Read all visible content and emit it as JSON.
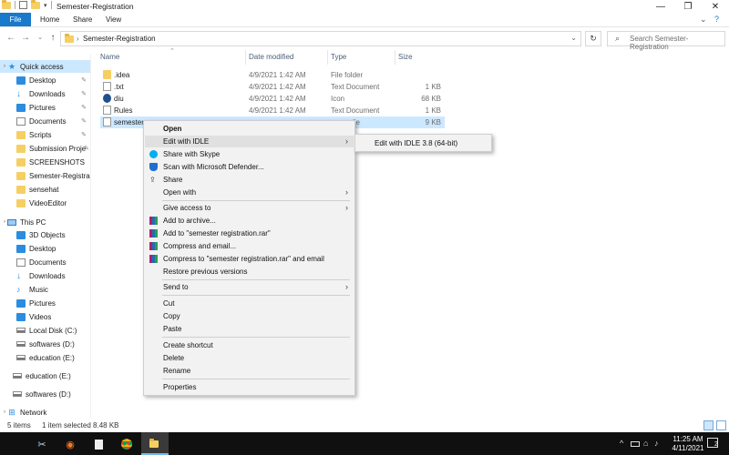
{
  "window": {
    "title": "Semester-Registration",
    "controls": {
      "minimize": "—",
      "maximize": "❐",
      "close": "✕"
    }
  },
  "ribbon": {
    "tabs": [
      "File",
      "Home",
      "Share",
      "View"
    ],
    "help_glyph": "?",
    "expand_glyph": "⌄"
  },
  "addressbar": {
    "path": "Semester-Registration",
    "search_placeholder": "Search Semester-Registration"
  },
  "sidebar": {
    "items": [
      {
        "label": "Quick access",
        "icon": "star-icon",
        "pinned": false
      },
      {
        "label": "Desktop",
        "icon": "folder-icon",
        "pinned": true
      },
      {
        "label": "Downloads",
        "icon": "download-icon",
        "pinned": true
      },
      {
        "label": "Pictures",
        "icon": "folder-icon",
        "pinned": true
      },
      {
        "label": "Documents",
        "icon": "folder-icon",
        "pinned": true
      },
      {
        "label": "Scripts",
        "icon": "folder-icon",
        "pinned": true
      },
      {
        "label": "Submission Proje",
        "icon": "folder-icon",
        "pinned": true
      },
      {
        "label": "SCREENSHOTS",
        "icon": "folder-icon",
        "pinned": false
      },
      {
        "label": "Semester-Registrati",
        "icon": "folder-icon",
        "pinned": false
      },
      {
        "label": "sensehat",
        "icon": "folder-icon",
        "pinned": false
      },
      {
        "label": "VideoEditor",
        "icon": "folder-icon",
        "pinned": false
      },
      {
        "label": "This PC",
        "icon": "pc-icon",
        "pinned": false
      },
      {
        "label": "3D Objects",
        "icon": "folder-icon",
        "pinned": false
      },
      {
        "label": "Desktop",
        "icon": "folder-icon",
        "pinned": false
      },
      {
        "label": "Documents",
        "icon": "folder-icon",
        "pinned": false
      },
      {
        "label": "Downloads",
        "icon": "download-icon",
        "pinned": false
      },
      {
        "label": "Music",
        "icon": "music-icon",
        "pinned": false
      },
      {
        "label": "Pictures",
        "icon": "folder-icon",
        "pinned": false
      },
      {
        "label": "Videos",
        "icon": "folder-icon",
        "pinned": false
      },
      {
        "label": "Local Disk (C:)",
        "icon": "drive-icon",
        "pinned": false
      },
      {
        "label": "softwares (D:)",
        "icon": "drive-icon",
        "pinned": false
      },
      {
        "label": "education (E:)",
        "icon": "drive-icon",
        "pinned": false
      },
      {
        "label": "education (E:)",
        "icon": "drive-icon",
        "pinned": false
      },
      {
        "label": "softwares (D:)",
        "icon": "drive-icon",
        "pinned": false
      },
      {
        "label": "Network",
        "icon": "network-icon",
        "pinned": false
      }
    ]
  },
  "filelist": {
    "columns": {
      "name": "Name",
      "date": "Date modified",
      "type": "Type",
      "size": "Size"
    },
    "rows": [
      {
        "name": ".idea",
        "date": "4/9/2021 1:42 AM",
        "type": "File folder",
        "size": "",
        "icon": "folder-icon"
      },
      {
        "name": ".txt",
        "date": "4/9/2021 1:42 AM",
        "type": "Text Document",
        "size": "1 KB",
        "icon": "document-icon"
      },
      {
        "name": "diu",
        "date": "4/9/2021 1:42 AM",
        "type": "Icon",
        "size": "68 KB",
        "icon": "ico-file-icon"
      },
      {
        "name": "Rules",
        "date": "4/9/2021 1:42 AM",
        "type": "Text Document",
        "size": "1 KB",
        "icon": "document-icon"
      },
      {
        "name": "semester r",
        "date": "",
        "type": "ile",
        "size": "9 KB",
        "icon": "python-file-icon"
      }
    ]
  },
  "status": {
    "items_count": "5 items",
    "selection": "1 item selected  8.48 KB"
  },
  "context_menu": {
    "items": [
      {
        "label": "Open",
        "bold": true,
        "submenu": false,
        "icon": ""
      },
      {
        "label": "Edit with IDLE",
        "bold": false,
        "submenu": true,
        "icon": ""
      },
      {
        "label": "Share with Skype",
        "bold": false,
        "submenu": false,
        "icon": "skype-icon"
      },
      {
        "label": "Scan with Microsoft Defender...",
        "bold": false,
        "submenu": false,
        "icon": "defender-icon"
      },
      {
        "label": "Share",
        "bold": false,
        "submenu": false,
        "icon": "share-icon"
      },
      {
        "label": "Open with",
        "bold": false,
        "submenu": true,
        "icon": ""
      },
      {
        "label": "Give access to",
        "bold": false,
        "submenu": true,
        "icon": ""
      },
      {
        "label": "Add to archive...",
        "bold": false,
        "submenu": false,
        "icon": "winrar-icon"
      },
      {
        "label": "Add to \"semester registration.rar\"",
        "bold": false,
        "submenu": false,
        "icon": "winrar-icon"
      },
      {
        "label": "Compress and email...",
        "bold": false,
        "submenu": false,
        "icon": "winrar-icon"
      },
      {
        "label": "Compress to \"semester registration.rar\" and email",
        "bold": false,
        "submenu": false,
        "icon": "winrar-icon"
      },
      {
        "label": "Restore previous versions",
        "bold": false,
        "submenu": false,
        "icon": ""
      },
      {
        "label": "Send to",
        "bold": false,
        "submenu": true,
        "icon": ""
      },
      {
        "label": "Cut",
        "bold": false,
        "submenu": false,
        "icon": ""
      },
      {
        "label": "Copy",
        "bold": false,
        "submenu": false,
        "icon": ""
      },
      {
        "label": "Paste",
        "bold": false,
        "submenu": false,
        "icon": ""
      },
      {
        "label": "Create shortcut",
        "bold": false,
        "submenu": false,
        "icon": ""
      },
      {
        "label": "Delete",
        "bold": false,
        "submenu": false,
        "icon": ""
      },
      {
        "label": "Rename",
        "bold": false,
        "submenu": false,
        "icon": ""
      },
      {
        "label": "Properties",
        "bold": false,
        "submenu": false,
        "icon": ""
      }
    ],
    "submenu_arrow": "›",
    "submenu": {
      "label": "Edit with IDLE 3.8 (64-bit)"
    }
  },
  "taskbar": {
    "apps": [
      "snipping-tool-icon",
      "blender-icon",
      "file-icon",
      "chrome-icon",
      "file-explorer-icon"
    ],
    "tray_glyphs": {
      "chevron": "^",
      "network": "⌂",
      "volume": "♪"
    },
    "time": "11:25 AM",
    "date": "4/11/2021",
    "notifications": "2"
  },
  "colors": {
    "accent": "#1979ca",
    "selection": "#cce8ff",
    "menu_bg": "#f2f2f2",
    "taskbar_bg": "#101010"
  }
}
